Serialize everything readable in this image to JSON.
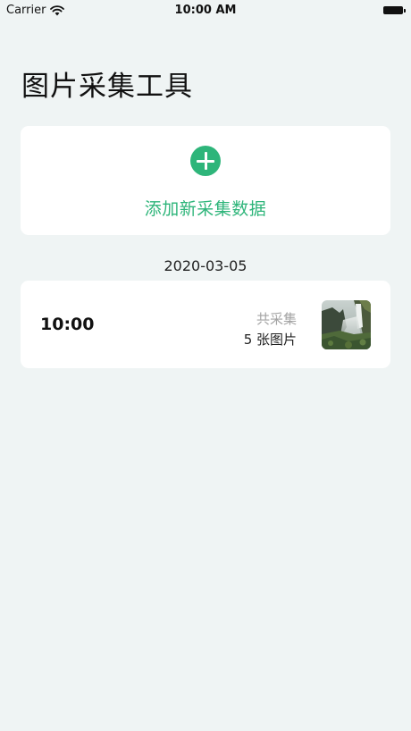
{
  "status_bar": {
    "carrier": "Carrier",
    "time": "10:00 AM"
  },
  "page": {
    "title": "图片采集工具"
  },
  "add_card": {
    "label": "添加新采集数据",
    "icon": "plus-circle-icon",
    "accent_color": "#2eb57a"
  },
  "records": {
    "date": "2020-03-05",
    "items": [
      {
        "time": "10:00",
        "summary_label": "共采集",
        "count_text": "5 张图片",
        "thumbnail": "waterfall-photo"
      }
    ]
  }
}
